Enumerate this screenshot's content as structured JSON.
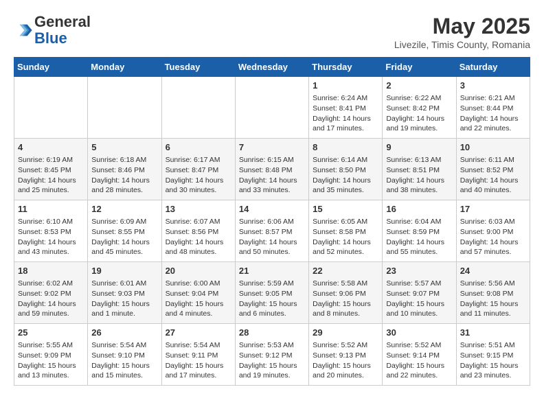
{
  "header": {
    "logo_general": "General",
    "logo_blue": "Blue",
    "title": "May 2025",
    "subtitle": "Livezile, Timis County, Romania"
  },
  "weekdays": [
    "Sunday",
    "Monday",
    "Tuesday",
    "Wednesday",
    "Thursday",
    "Friday",
    "Saturday"
  ],
  "weeks": [
    [
      {
        "day": "",
        "info": ""
      },
      {
        "day": "",
        "info": ""
      },
      {
        "day": "",
        "info": ""
      },
      {
        "day": "",
        "info": ""
      },
      {
        "day": "1",
        "info": "Sunrise: 6:24 AM\nSunset: 8:41 PM\nDaylight: 14 hours and 17 minutes."
      },
      {
        "day": "2",
        "info": "Sunrise: 6:22 AM\nSunset: 8:42 PM\nDaylight: 14 hours and 19 minutes."
      },
      {
        "day": "3",
        "info": "Sunrise: 6:21 AM\nSunset: 8:44 PM\nDaylight: 14 hours and 22 minutes."
      }
    ],
    [
      {
        "day": "4",
        "info": "Sunrise: 6:19 AM\nSunset: 8:45 PM\nDaylight: 14 hours and 25 minutes."
      },
      {
        "day": "5",
        "info": "Sunrise: 6:18 AM\nSunset: 8:46 PM\nDaylight: 14 hours and 28 minutes."
      },
      {
        "day": "6",
        "info": "Sunrise: 6:17 AM\nSunset: 8:47 PM\nDaylight: 14 hours and 30 minutes."
      },
      {
        "day": "7",
        "info": "Sunrise: 6:15 AM\nSunset: 8:48 PM\nDaylight: 14 hours and 33 minutes."
      },
      {
        "day": "8",
        "info": "Sunrise: 6:14 AM\nSunset: 8:50 PM\nDaylight: 14 hours and 35 minutes."
      },
      {
        "day": "9",
        "info": "Sunrise: 6:13 AM\nSunset: 8:51 PM\nDaylight: 14 hours and 38 minutes."
      },
      {
        "day": "10",
        "info": "Sunrise: 6:11 AM\nSunset: 8:52 PM\nDaylight: 14 hours and 40 minutes."
      }
    ],
    [
      {
        "day": "11",
        "info": "Sunrise: 6:10 AM\nSunset: 8:53 PM\nDaylight: 14 hours and 43 minutes."
      },
      {
        "day": "12",
        "info": "Sunrise: 6:09 AM\nSunset: 8:55 PM\nDaylight: 14 hours and 45 minutes."
      },
      {
        "day": "13",
        "info": "Sunrise: 6:07 AM\nSunset: 8:56 PM\nDaylight: 14 hours and 48 minutes."
      },
      {
        "day": "14",
        "info": "Sunrise: 6:06 AM\nSunset: 8:57 PM\nDaylight: 14 hours and 50 minutes."
      },
      {
        "day": "15",
        "info": "Sunrise: 6:05 AM\nSunset: 8:58 PM\nDaylight: 14 hours and 52 minutes."
      },
      {
        "day": "16",
        "info": "Sunrise: 6:04 AM\nSunset: 8:59 PM\nDaylight: 14 hours and 55 minutes."
      },
      {
        "day": "17",
        "info": "Sunrise: 6:03 AM\nSunset: 9:00 PM\nDaylight: 14 hours and 57 minutes."
      }
    ],
    [
      {
        "day": "18",
        "info": "Sunrise: 6:02 AM\nSunset: 9:02 PM\nDaylight: 14 hours and 59 minutes."
      },
      {
        "day": "19",
        "info": "Sunrise: 6:01 AM\nSunset: 9:03 PM\nDaylight: 15 hours and 1 minute."
      },
      {
        "day": "20",
        "info": "Sunrise: 6:00 AM\nSunset: 9:04 PM\nDaylight: 15 hours and 4 minutes."
      },
      {
        "day": "21",
        "info": "Sunrise: 5:59 AM\nSunset: 9:05 PM\nDaylight: 15 hours and 6 minutes."
      },
      {
        "day": "22",
        "info": "Sunrise: 5:58 AM\nSunset: 9:06 PM\nDaylight: 15 hours and 8 minutes."
      },
      {
        "day": "23",
        "info": "Sunrise: 5:57 AM\nSunset: 9:07 PM\nDaylight: 15 hours and 10 minutes."
      },
      {
        "day": "24",
        "info": "Sunrise: 5:56 AM\nSunset: 9:08 PM\nDaylight: 15 hours and 11 minutes."
      }
    ],
    [
      {
        "day": "25",
        "info": "Sunrise: 5:55 AM\nSunset: 9:09 PM\nDaylight: 15 hours and 13 minutes."
      },
      {
        "day": "26",
        "info": "Sunrise: 5:54 AM\nSunset: 9:10 PM\nDaylight: 15 hours and 15 minutes."
      },
      {
        "day": "27",
        "info": "Sunrise: 5:54 AM\nSunset: 9:11 PM\nDaylight: 15 hours and 17 minutes."
      },
      {
        "day": "28",
        "info": "Sunrise: 5:53 AM\nSunset: 9:12 PM\nDaylight: 15 hours and 19 minutes."
      },
      {
        "day": "29",
        "info": "Sunrise: 5:52 AM\nSunset: 9:13 PM\nDaylight: 15 hours and 20 minutes."
      },
      {
        "day": "30",
        "info": "Sunrise: 5:52 AM\nSunset: 9:14 PM\nDaylight: 15 hours and 22 minutes."
      },
      {
        "day": "31",
        "info": "Sunrise: 5:51 AM\nSunset: 9:15 PM\nDaylight: 15 hours and 23 minutes."
      }
    ]
  ]
}
